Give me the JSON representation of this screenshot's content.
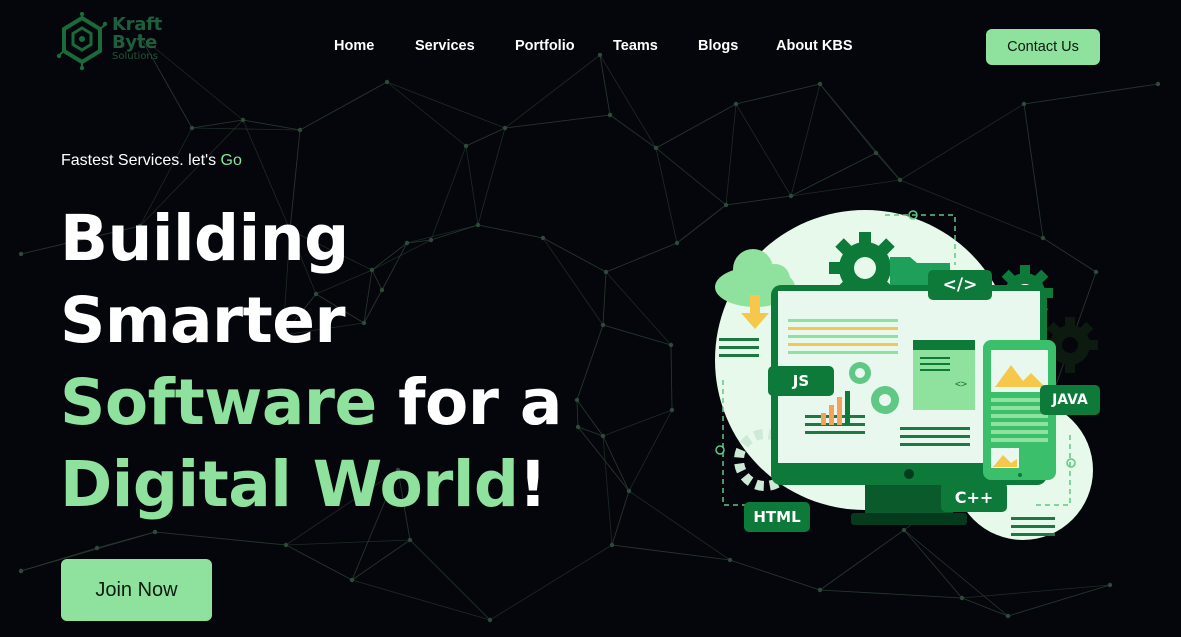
{
  "brand": {
    "name_line1": "Kraft",
    "name_line2": "Byte",
    "name_line3": "Solutions",
    "logo_icon": "hexagon-circuit-logo",
    "color": "#1f5e3c"
  },
  "nav": {
    "items": [
      {
        "label": "Home"
      },
      {
        "label": "Services"
      },
      {
        "label": "Portfolio"
      },
      {
        "label": "Teams"
      },
      {
        "label": "Blogs"
      },
      {
        "label": "About KBS"
      }
    ],
    "contact_label": "Contact Us"
  },
  "hero": {
    "tagline_prefix": "Fastest Services. let's ",
    "tagline_accent": "Go",
    "line1": "Building",
    "line2": "Smarter",
    "line3_accent": "Software",
    "line3_rest": " for a",
    "line4_accent": "Digital World",
    "line4_rest": "!",
    "cta_label": "Join Now"
  },
  "illustration": {
    "chips": {
      "code": "</>",
      "js": "JS",
      "java": "JAVA",
      "html": "HTML",
      "cpp": "C++"
    }
  },
  "colors": {
    "background": "#04060b",
    "accent": "#8ee29d",
    "chip": "#0d7a3a",
    "network": "#2a3a31"
  }
}
